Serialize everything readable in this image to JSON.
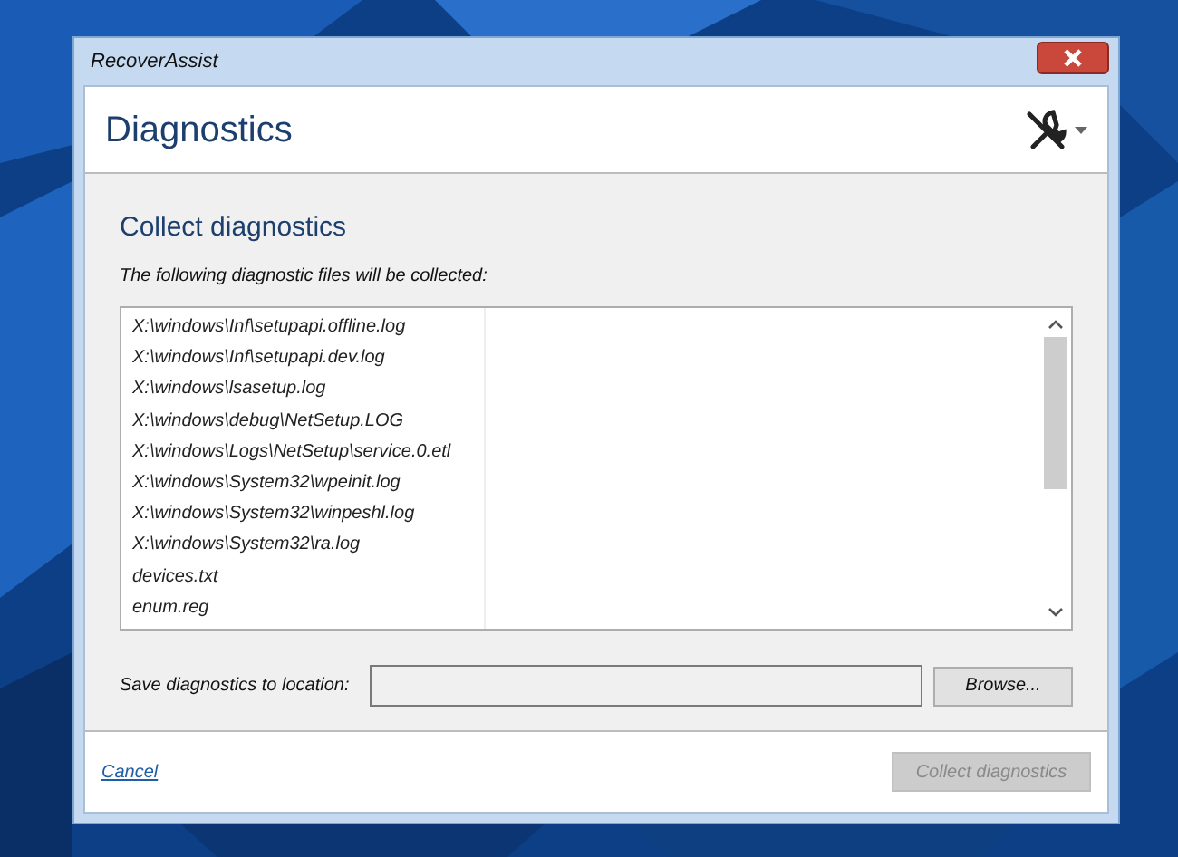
{
  "window": {
    "title": "RecoverAssist"
  },
  "header": {
    "title": "Diagnostics"
  },
  "section": {
    "title": "Collect diagnostics",
    "description": "The following diagnostic files will be collected:"
  },
  "files": [
    "X:\\windows\\Inf\\setupapi.offline.log",
    "X:\\windows\\Inf\\setupapi.dev.log",
    "X:\\windows\\lsasetup.log",
    "X:\\windows\\debug\\NetSetup.LOG",
    "X:\\windows\\Logs\\NetSetup\\service.0.etl",
    "X:\\windows\\System32\\wpeinit.log",
    "X:\\windows\\System32\\winpeshl.log",
    "X:\\windows\\System32\\ra.log",
    "devices.txt",
    "enum.reg"
  ],
  "location": {
    "label": "Save diagnostics to location:",
    "browse": "Browse..."
  },
  "footer": {
    "cancel": "Cancel",
    "collect": {
      "label": "Collect diagnostics",
      "disabled": true
    }
  }
}
